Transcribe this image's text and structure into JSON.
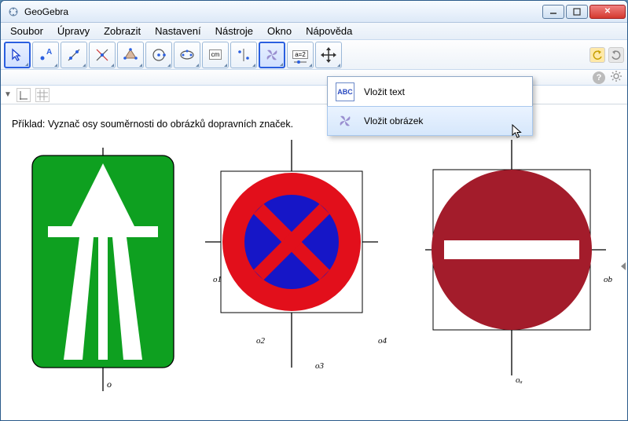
{
  "window": {
    "title": "GeoGebra"
  },
  "menubar": {
    "items": [
      "Soubor",
      "Úpravy",
      "Zobrazit",
      "Nastavení",
      "Nástroje",
      "Okno",
      "Nápověda"
    ]
  },
  "toolbar": {
    "tools": [
      {
        "name": "move-tool",
        "kind": "arrow",
        "selected": true
      },
      {
        "name": "point-tool",
        "kind": "point"
      },
      {
        "name": "line-tool",
        "kind": "line"
      },
      {
        "name": "perpendicular-tool",
        "kind": "perp"
      },
      {
        "name": "polygon-tool",
        "kind": "polygon"
      },
      {
        "name": "circle-tool",
        "kind": "circle"
      },
      {
        "name": "conic-tool",
        "kind": "conic"
      },
      {
        "name": "angle-tool",
        "kind": "angle",
        "label": "cm"
      },
      {
        "name": "transform-tool",
        "kind": "transform"
      },
      {
        "name": "insert-tool",
        "kind": "pinwheel",
        "active": true
      },
      {
        "name": "slider-tool",
        "kind": "slider",
        "label": "a=2"
      },
      {
        "name": "move-view-tool",
        "kind": "movecross"
      }
    ]
  },
  "dropdown": {
    "items": [
      {
        "name": "insert-text",
        "icon": "ABC",
        "label": "Vložit text"
      },
      {
        "name": "insert-image",
        "icon": "pinwheel",
        "label": "Vložit obrázek",
        "hover": true
      }
    ]
  },
  "content": {
    "task_text": "Příklad: Vyznač osy souměrnosti do obrázků dopravních značek.",
    "labels": {
      "o": "o",
      "o1": "o1",
      "o2": "o2",
      "o3": "o3",
      "o4": "o4",
      "oa": "oₐ",
      "ob": "ob"
    }
  },
  "inputbar": {
    "placeholder": ""
  }
}
